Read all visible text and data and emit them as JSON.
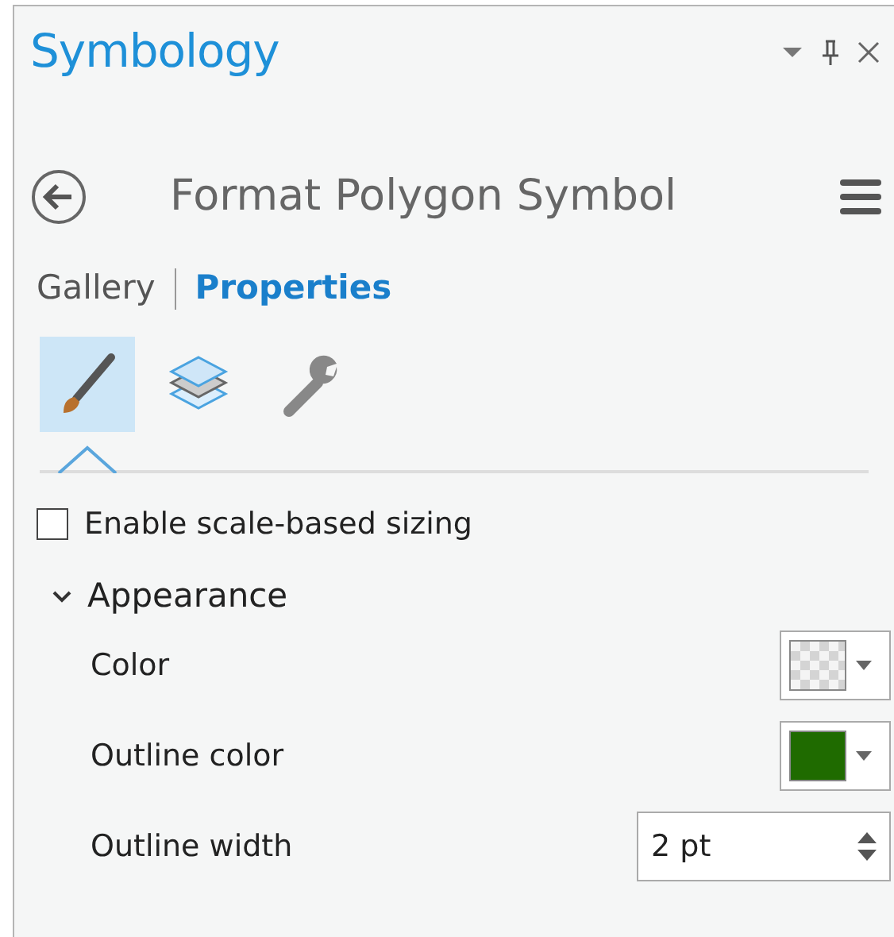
{
  "pane": {
    "title": "Symbology"
  },
  "header": {
    "title": "Format Polygon Symbol"
  },
  "tabs": [
    {
      "label": "Gallery",
      "selected": false
    },
    {
      "label": "Properties",
      "selected": true
    }
  ],
  "icon_tabs": [
    {
      "kind": "brush",
      "selected": true
    },
    {
      "kind": "layers",
      "selected": false
    },
    {
      "kind": "wrench",
      "selected": false
    }
  ],
  "scale_sizing": {
    "label": "Enable scale-based sizing",
    "checked": false
  },
  "section": {
    "title": "Appearance",
    "expanded": true,
    "rows": [
      {
        "label": "Color",
        "kind": "no-color"
      },
      {
        "label": "Outline color",
        "kind": "color",
        "color": "#1f6b00"
      },
      {
        "label": "Outline width",
        "kind": "number",
        "value": "2 pt"
      }
    ]
  }
}
